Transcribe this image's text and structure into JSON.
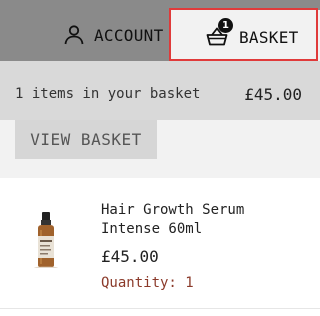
{
  "header": {
    "account_label": "ACCOUNT",
    "account_icon": "user-icon",
    "basket_label": "BASKET",
    "basket_icon": "basket-icon",
    "basket_badge": "1"
  },
  "summary": {
    "count_text": "1 items in your basket",
    "total": "£45.00"
  },
  "actions": {
    "view_basket_label": "VIEW BASKET"
  },
  "items": [
    {
      "name": "Hair Growth Serum Intense 60ml",
      "price": "£45.00",
      "quantity_text": "Quantity: 1",
      "image_icon": "product-bottle-icon"
    }
  ],
  "colors": {
    "header_bg": "#8a8a8a",
    "active_tab_bg": "#f2f2f2",
    "highlight": "#e03a3a",
    "summary_bg": "#d9d9d9",
    "button_bg": "#d6d6d6",
    "quantity_text": "#8b3a2a"
  }
}
